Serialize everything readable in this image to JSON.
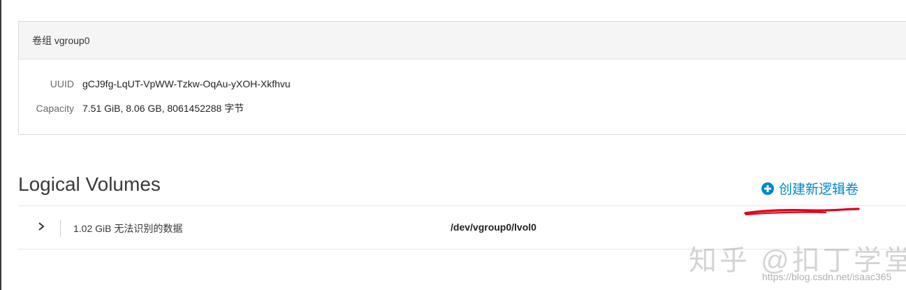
{
  "volume_group": {
    "header": "卷组 vgroup0",
    "uuid_label": "UUID",
    "uuid_value": "gCJ9fg-LqUT-VpWW-Tzkw-OqAu-yXOH-Xkfhvu",
    "capacity_label": "Capacity",
    "capacity_value": "7.51 GiB, 8.06 GB, 8061452288 字节"
  },
  "logical_volumes": {
    "title": "Logical Volumes",
    "create_label": "创建新逻辑卷",
    "rows": [
      {
        "size_desc": "1.02 GiB 无法识别的数据",
        "path": "/dev/vgroup0/lvol0"
      }
    ]
  },
  "watermark": {
    "text": "知乎 @扣丁学堂",
    "url": "https://blog.csdn.net/isaac365"
  },
  "colors": {
    "link": "#0088ce",
    "annotation": "#e0001a"
  },
  "icons": {
    "create": "plus-circle-icon",
    "expand": "chevron-right-icon"
  }
}
